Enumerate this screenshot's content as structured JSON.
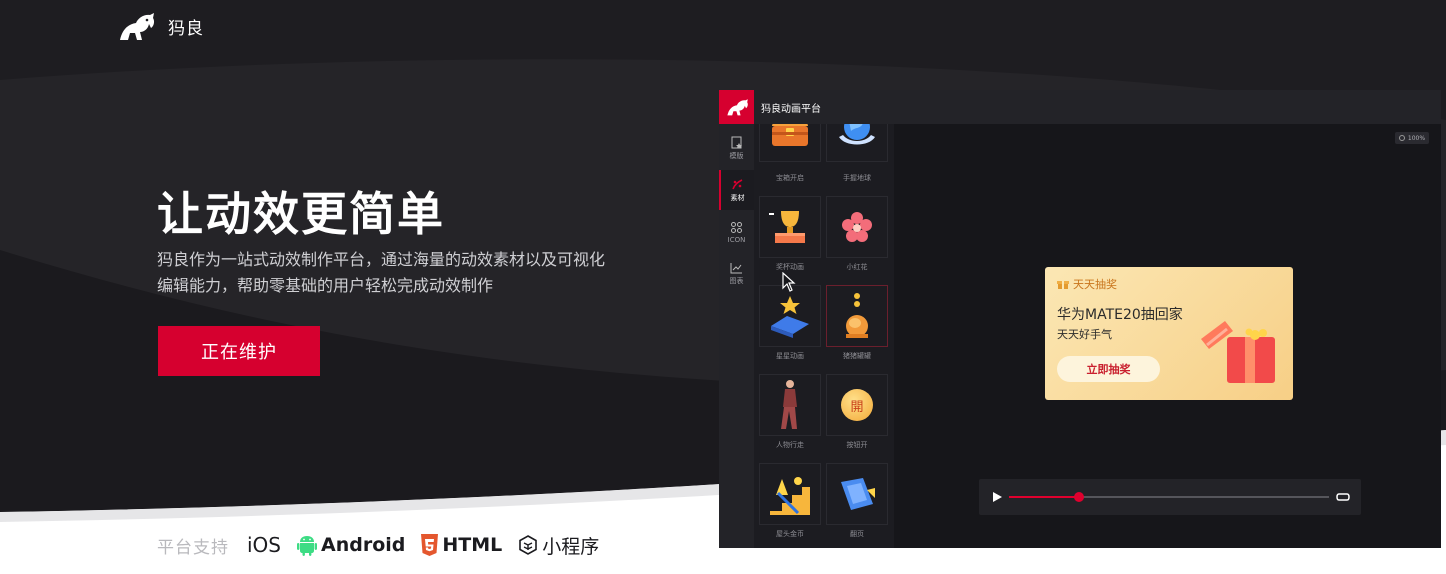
{
  "nav": {
    "brand": "犸良",
    "logo_icon": "elephant-logo-icon"
  },
  "hero": {
    "title": "让动效更简单",
    "description_line1": "犸良作为一站式动效制作平台，通过海量的动效素材以及可视化",
    "description_line2": "编辑能力，帮助零基础的用户轻松完成动效制作",
    "cta_label": "正在维护"
  },
  "platforms": {
    "label": "平台支持",
    "items": [
      {
        "name": "iOS",
        "icon": ""
      },
      {
        "name": "Android",
        "icon": "android-icon"
      },
      {
        "name": "HTML",
        "icon": "html5-icon"
      },
      {
        "name": "小程序",
        "icon": "miniprogram-icon"
      }
    ]
  },
  "app": {
    "title": "犸良动画平台",
    "rail": [
      {
        "label": "模版",
        "icon": "template-icon"
      },
      {
        "label": "素材",
        "icon": "material-icon",
        "active": true
      },
      {
        "label": "ICON",
        "icon": "command-icon"
      },
      {
        "label": "图表",
        "icon": "chart-icon"
      }
    ],
    "assets": [
      {
        "label": "宝箱开启",
        "icon": "treasure-chest-icon"
      },
      {
        "label": "手握地球",
        "icon": "globe-hands-icon"
      },
      {
        "label": "奖杯动画",
        "icon": "trophy-icon"
      },
      {
        "label": "小红花",
        "icon": "flower-icon"
      },
      {
        "label": "星星动画",
        "icon": "star-icon"
      },
      {
        "label": "猪猪罐罐",
        "icon": "piggy-bank-icon"
      },
      {
        "label": "人物行走",
        "icon": "walking-person-icon"
      },
      {
        "label": "按钮开",
        "icon": "open-button-icon",
        "glyph": "開"
      },
      {
        "label": "屋头金币",
        "icon": "coin-stairs-icon"
      },
      {
        "label": "翻页",
        "icon": "page-flip-icon"
      }
    ],
    "zoom": "100%",
    "banner": {
      "tag": "天天抽奖",
      "title": "华为MATE20抽回家",
      "subtitle": "天天好手气",
      "button": "立即抽奖"
    },
    "player": {
      "progress": 0.22
    }
  },
  "colors": {
    "accent": "#d6002f",
    "hero_dark": "#1e1d21"
  }
}
